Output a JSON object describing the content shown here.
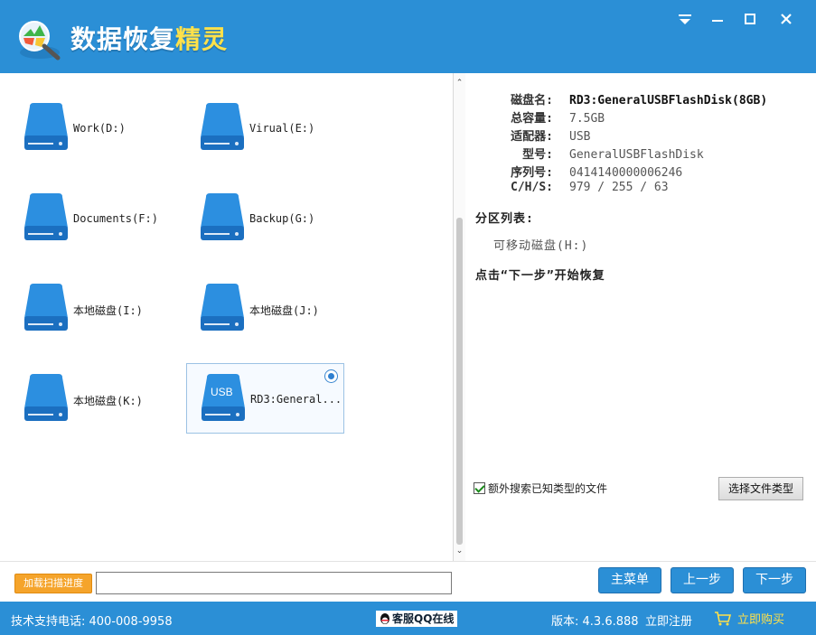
{
  "app": {
    "title_main": "数据恢复",
    "title_accent": "精灵"
  },
  "drives": [
    {
      "label": "Work(D:)"
    },
    {
      "label": "Virual(E:)"
    },
    {
      "label": "Documents(F:)"
    },
    {
      "label": "Backup(G:)"
    },
    {
      "label": "本地磁盘(I:)"
    },
    {
      "label": "本地磁盘(J:)"
    },
    {
      "label": "本地磁盘(K:)"
    },
    {
      "label": "RD3:General...",
      "badge": "USB",
      "selected": true
    }
  ],
  "details": {
    "rows": [
      {
        "key": "磁盘名:",
        "value": "RD3:GeneralUSBFlashDisk(8GB)"
      },
      {
        "key": "总容量:",
        "value": "7.5GB"
      },
      {
        "key": "适配器:",
        "value": "USB"
      },
      {
        "key": "型号:",
        "value": "GeneralUSBFlashDisk"
      },
      {
        "key": "序列号:",
        "value": "0414140000006246"
      },
      {
        "key": "C/H/S:",
        "value": "979 / 255 / 63"
      }
    ],
    "partition_title": "分区列表:",
    "partition_item": "可移动磁盘(H:)",
    "hint": "点击“下一步”开始恢复",
    "checkbox_label": "额外搜索已知类型的文件",
    "file_type_button": "选择文件类型"
  },
  "bottom": {
    "load_progress_button": "加载扫描进度",
    "main_menu_button": "主菜单",
    "prev_button": "上一步",
    "next_button": "下一步"
  },
  "status": {
    "support_phone": "技术支持电话: 400-008-9958",
    "qq_button": "客服QQ在线",
    "version": "版本: 4.3.6.888",
    "register": "立即注册",
    "buy": "立即购买"
  },
  "colors": {
    "brand_blue": "#2b8fd6",
    "accent_yellow": "#ffe14a",
    "progress_orange": "#f5a42b"
  }
}
